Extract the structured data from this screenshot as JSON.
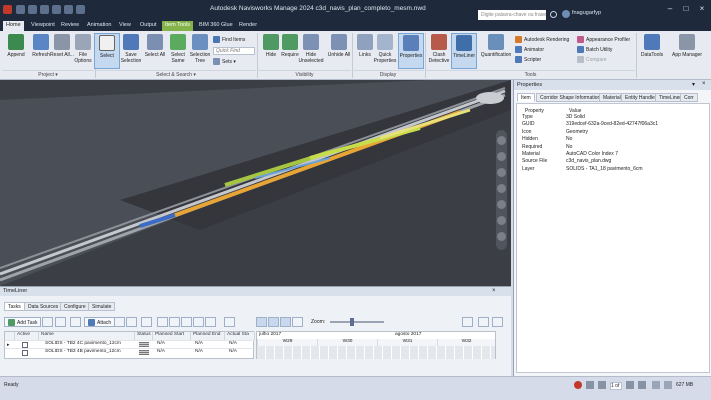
{
  "titlebar": {
    "title": "Autodesk Navisworks Manage 2024   c3d_navis_plan_completo_mesm.nwd",
    "search_placeholder": "Digite palavra-chave ou frase",
    "user": "fnagugarfyp"
  },
  "tabs": [
    "Home",
    "Viewpoint",
    "Review",
    "Animation",
    "View",
    "Output",
    "Item Tools",
    "BIM 360 Glue",
    "Render"
  ],
  "ribbon": {
    "buttons": {
      "append": "Append",
      "refresh": "Refresh",
      "reset": "Reset All...",
      "file_options": "File Options",
      "select": "Select",
      "save_selection": "Save Selection",
      "select_all": "Select All",
      "select_same": "Select Same",
      "selection_tree": "Selection Tree",
      "hide": "Hide",
      "require": "Require",
      "hide_unselected": "Hide Unselected",
      "unhide_all": "Unhide All",
      "links": "Links",
      "quick_properties": "Quick Properties",
      "properties": "Properties",
      "clash_detective": "Clash Detective",
      "timeliner": "TimeLiner",
      "quantification": "Quantification",
      "datatools": "DataTools",
      "app_manager": "App Manager"
    },
    "small": {
      "find_items": "Find Items",
      "quick_find": "Quick Find",
      "sets": "Sets",
      "autodesk_rendering": "Autodesk Rendering",
      "animator": "Animator",
      "scripter": "Scripter",
      "appearance_profiler": "Appearance Profiler",
      "batch_utility": "Batch Utility",
      "compare": "Compare"
    },
    "groups": {
      "project": "Project ▾",
      "select_search": "Select & Search ▾",
      "visibility": "Visibility",
      "display": "Display",
      "tools": "Tools"
    }
  },
  "properties": {
    "title": "Properties",
    "tabs": [
      "Item",
      "Corridor Shape Information",
      "Material",
      "Entity Handle",
      "TimeLiner",
      "Corr"
    ],
    "col_property": "Property",
    "col_value": "Value",
    "rows": [
      {
        "k": "Type",
        "v": "3D Solid"
      },
      {
        "k": "GUID",
        "v": "319edcef-632a-9ced-82ed-42747f06a3c1"
      },
      {
        "k": "Icon",
        "v": "Geometry"
      },
      {
        "k": "Hidden",
        "v": "No"
      },
      {
        "k": "Required",
        "v": "No"
      },
      {
        "k": "Material",
        "v": "AutoCAD Color Index 7"
      },
      {
        "k": "Source File",
        "v": "c3d_navis_plan.dwg"
      },
      {
        "k": "Layer",
        "v": "SOLIDS - TA1_18 pavimento_6cm"
      }
    ]
  },
  "timeliner": {
    "title": "TimeLiner",
    "tabs": [
      "Tasks",
      "Data Sources",
      "Configure",
      "Simulate"
    ],
    "add_task": "Add Task",
    "attach": "Attach",
    "zoom_label": "Zoom:",
    "columns": [
      "Active",
      "Name",
      "Status",
      "Planned Start",
      "Planned End",
      "Actual Sta"
    ],
    "tasks": [
      {
        "name": "SOLIDS - TB2 4C pavimento_12cm",
        "start": "N/A",
        "end": "N/A",
        "actual": "N/A"
      },
      {
        "name": "SOLIDS - TB3 4B pavimento_12cm",
        "start": "N/A",
        "end": "N/A",
        "actual": "N/A"
      }
    ],
    "months": [
      "julho 2017",
      "agosto 2017"
    ],
    "weeks": [
      "W29",
      "W30",
      "W31",
      "W32"
    ]
  },
  "status": {
    "text": "Ready",
    "memory": "627 MB",
    "page": "1 of 1"
  }
}
